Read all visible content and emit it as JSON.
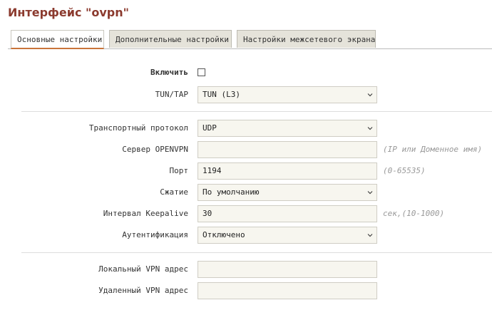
{
  "page": {
    "title": "Интерфейс \"ovpn\""
  },
  "tabs": [
    {
      "label": "Основные настройки",
      "active": true
    },
    {
      "label": "Дополнительные настройки",
      "active": false
    },
    {
      "label": "Настройки межсетевого экрана",
      "active": false
    }
  ],
  "form": {
    "enable": {
      "label": "Включить",
      "checked": false
    },
    "tuntap": {
      "label": "TUN/TAP",
      "value": "TUN (L3)"
    },
    "protocol": {
      "label": "Транспортный протокол",
      "value": "UDP"
    },
    "server": {
      "label": "Сервер OPENVPN",
      "value": "",
      "hint": "(IP или Доменное имя)"
    },
    "port": {
      "label": "Порт",
      "value": "1194",
      "hint": "(0-65535)"
    },
    "compression": {
      "label": "Сжатие",
      "value": "По умолчанию"
    },
    "keepalive": {
      "label": "Интервал Keepalive",
      "value": "30",
      "hint": "сек,(10-1000)"
    },
    "auth": {
      "label": "Аутентификация",
      "value": "Отключено"
    },
    "local_vpn": {
      "label": "Локальный VPN адрес",
      "value": ""
    },
    "remote_vpn": {
      "label": "Удаленный VPN адрес",
      "value": ""
    }
  },
  "colors": {
    "title": "#8b3a2e",
    "active_tab_underline": "#c9743a",
    "field_bg": "#f7f6ef"
  },
  "icons": {
    "select_arrow": "chevron-down-icon"
  }
}
